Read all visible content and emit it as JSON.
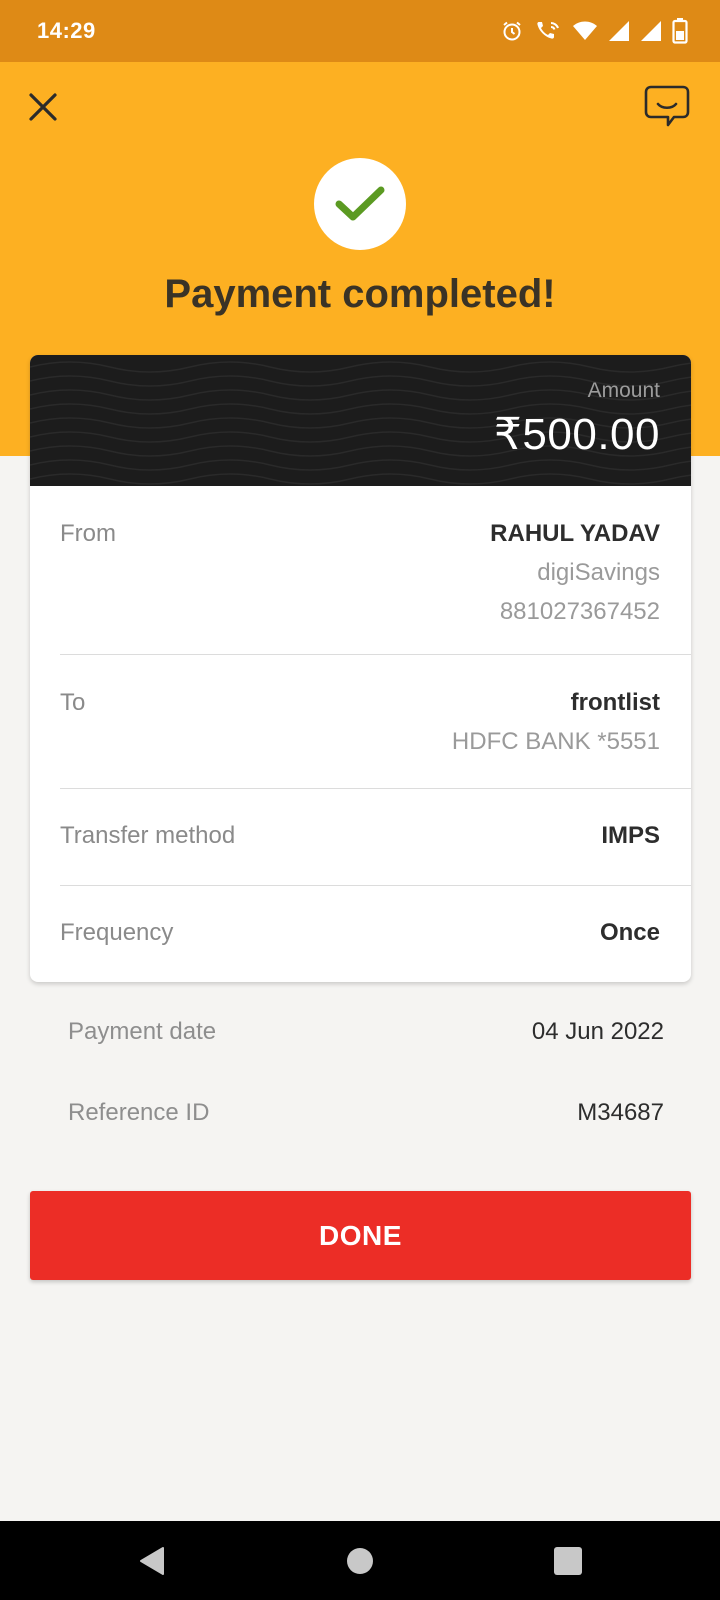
{
  "status_bar": {
    "time": "14:29",
    "icons": [
      "alarm-icon",
      "wifi-call-icon",
      "wifi-icon",
      "signal-icon",
      "signal-icon",
      "battery-icon"
    ]
  },
  "header": {
    "close_icon": "close-icon",
    "chat_icon": "chat-icon",
    "success_icon": "check-icon",
    "title": "Payment completed!",
    "background_color": "#fdb022"
  },
  "amount": {
    "label": "Amount",
    "value": "₹500.00"
  },
  "details": {
    "from": {
      "label": "From",
      "name": "RAHUL YADAV",
      "account_type": "digiSavings",
      "account_number": "881027367452"
    },
    "to": {
      "label": "To",
      "name": "frontlist",
      "bank": "HDFC BANK *5551"
    },
    "transfer_method": {
      "label": "Transfer method",
      "value": "IMPS"
    },
    "frequency": {
      "label": "Frequency",
      "value": "Once"
    }
  },
  "extra": {
    "payment_date": {
      "label": "Payment date",
      "value": "04 Jun 2022"
    },
    "reference_id": {
      "label": "Reference ID",
      "value": "M34687"
    }
  },
  "done_button": {
    "label": "DONE",
    "color": "#ec2d26"
  },
  "nav_bar": {
    "back_icon": "back-triangle-icon",
    "home_icon": "home-circle-icon",
    "recents_icon": "recents-square-icon"
  }
}
